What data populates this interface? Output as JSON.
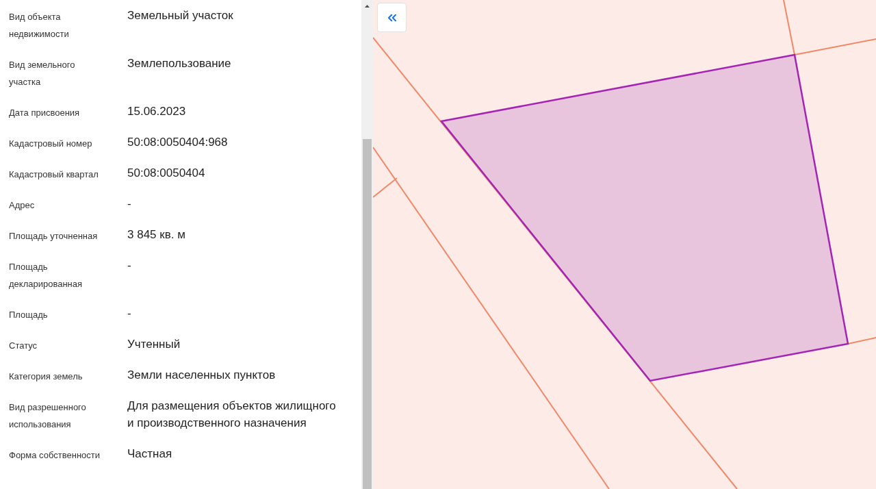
{
  "details": [
    {
      "label": "Вид объекта недвижимости",
      "value": "Земельный участок"
    },
    {
      "label": "Вид земельного участка",
      "value": "Землепользование"
    },
    {
      "label": "Дата присвоения",
      "value": "15.06.2023"
    },
    {
      "label": "Кадастровый номер",
      "value": "50:08:0050404:968"
    },
    {
      "label": "Кадастровый квартал",
      "value": "50:08:0050404"
    },
    {
      "label": "Адрес",
      "value": "-"
    },
    {
      "label": "Площадь уточненная",
      "value": "3 845 кв. м"
    },
    {
      "label": "Площадь декларированная",
      "value": "-"
    },
    {
      "label": "Площадь",
      "value": "-"
    },
    {
      "label": "Статус",
      "value": "Учтенный"
    },
    {
      "label": "Категория земель",
      "value": "Земли населенных пунктов"
    },
    {
      "label": "Вид разрешенного использования",
      "value": "Для размещения объектов жилищного и производственного назначения"
    },
    {
      "label": "Форма собственности",
      "value": "Частная"
    }
  ]
}
